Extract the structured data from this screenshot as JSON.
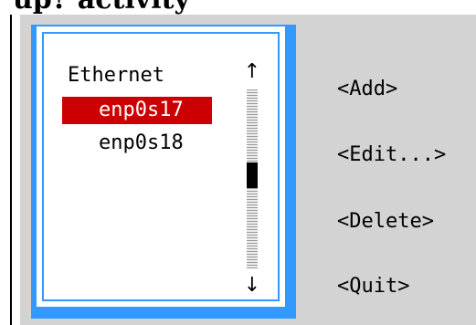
{
  "page": {
    "heading": "up? activity"
  },
  "connections_list": {
    "category_label": "Ethernet",
    "devices": [
      "enp0s17",
      "enp0s18"
    ],
    "selected_index": 0,
    "scroll_up_glyph": "↑",
    "scroll_down_glyph": "↓",
    "scroll_position": 0.5
  },
  "actions": {
    "add": "<Add>",
    "edit": "<Edit...>",
    "delete": "<Delete>",
    "quit": "<Quit>"
  },
  "colors": {
    "dialog_background": "#d3d3d3",
    "panel_border": "#3399ff",
    "selected_row": "#cc0000",
    "text": "#000000"
  }
}
